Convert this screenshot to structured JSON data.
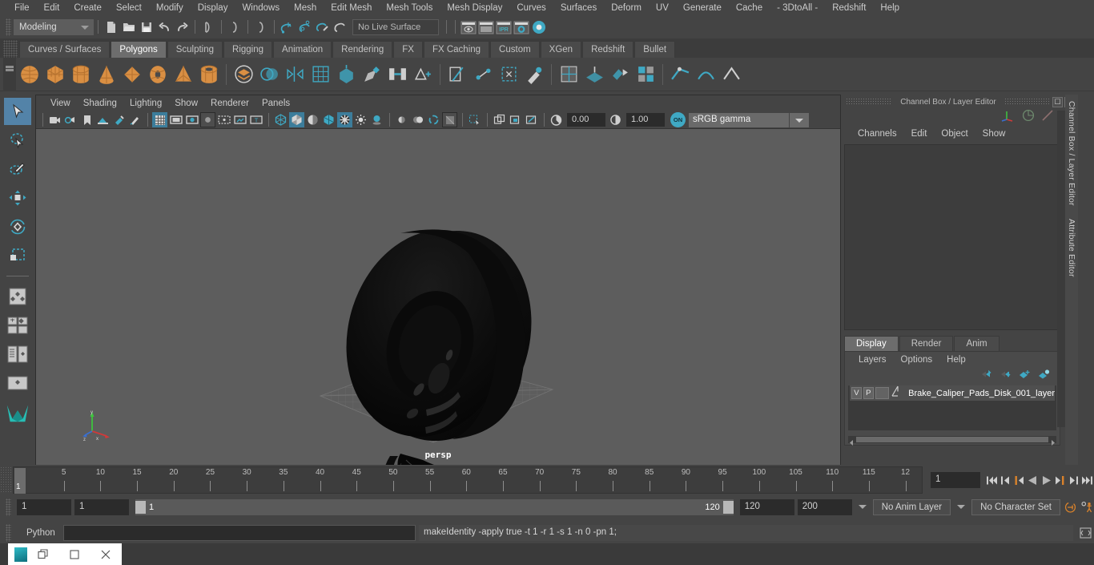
{
  "menubar": {
    "items": [
      "File",
      "Edit",
      "Create",
      "Select",
      "Modify",
      "Display",
      "Windows",
      "Mesh",
      "Edit Mesh",
      "Mesh Tools",
      "Mesh Display",
      "Curves",
      "Surfaces",
      "Deform",
      "UV",
      "Generate",
      "Cache",
      "- 3DtoAll -",
      "Redshift",
      "Help"
    ]
  },
  "statusline": {
    "menu_set": "Modeling",
    "live_surface": "No Live Surface",
    "icons": [
      "new-scene-icon",
      "open-scene-icon",
      "save-scene-icon",
      "undo-icon",
      "redo-icon",
      "select-by-hierarchy-icon",
      "select-by-object-icon",
      "select-by-component-icon",
      "snap-to-grid-icon",
      "snap-to-curve-icon",
      "snap-to-point-icon",
      "snap-to-projected-center-icon",
      "snap-to-view-plane-icon",
      "make-live-icon",
      "render-view-icon",
      "render-sequence-icon",
      "ipr-render-icon",
      "render-settings-icon",
      "hypershade-icon"
    ],
    "render_labels": [
      "IPR"
    ]
  },
  "shelf": {
    "tabs": [
      "Curves / Surfaces",
      "Polygons",
      "Sculpting",
      "Rigging",
      "Animation",
      "Rendering",
      "FX",
      "FX Caching",
      "Custom",
      "XGen",
      "Redshift",
      "Bullet"
    ],
    "active_tab": "Polygons",
    "icons": [
      "poly-sphere-icon",
      "poly-cube-icon",
      "poly-cylinder-icon",
      "poly-cone-icon",
      "poly-plane-icon",
      "poly-torus-icon",
      "poly-pyramid-icon",
      "poly-pipe-icon",
      "poly-combine-icon",
      "poly-booleans-icon",
      "poly-mirror-icon",
      "poly-smooth-icon",
      "poly-extrude-icon",
      "poly-bevel-icon",
      "poly-bridge-icon",
      "poly-append-icon",
      "poly-multicut-icon",
      "poly-target-weld-icon",
      "poly-quad-draw-icon",
      "poly-sculpt-icon",
      "poly-uv-editor-icon",
      "poly-planar-icon",
      "poly-unfold-icon",
      "poly-layout-icon",
      "crease-tool-icon",
      "soften-edge-icon",
      "harden-edge-icon",
      "cleanup-icon",
      "reduce-icon",
      "triangulate-icon"
    ]
  },
  "toolbox": {
    "tools": [
      "select-tool",
      "lasso-select-tool",
      "paint-select-tool",
      "move-tool",
      "rotate-tool",
      "scale-tool",
      "last-tool-used",
      "four-view-layout-icon",
      "single-perspective-layout-icon",
      "two-pane-layout-icon",
      "outliner-persp-layout-icon",
      "hypergraph-persp-layout-icon",
      "persp-graph-layout-icon",
      "maya-logo-icon"
    ],
    "active": "select-tool"
  },
  "viewport": {
    "menu": [
      "View",
      "Shading",
      "Lighting",
      "Show",
      "Renderer",
      "Panels"
    ],
    "camera_label": "persp",
    "exposure": "0.00",
    "gamma": "1.00",
    "gamma_toggle": "ON",
    "color_management": "sRGB gamma",
    "toolbar_icons": [
      "select-camera-icon",
      "camera-attributes-icon",
      "bookmark-icon",
      "image-plane-icon",
      "two-sided-lighting-icon",
      "paint-effects-icon",
      "grid-toggle-icon",
      "film-gate-icon",
      "resolution-gate-icon",
      "gate-mask-icon",
      "film-origin-icon",
      "safe-action-icon",
      "title-safe-icon",
      "wireframe-icon",
      "smooth-shade-icon",
      "flat-shade-icon",
      "shaded-wireframe-icon",
      "textured-icon",
      "use-default-lighting-icon",
      "shadows-icon",
      "ambient-occlusion-icon",
      "motion-blur-icon",
      "multisample-icon",
      "isolate-select-icon",
      "xray-icon",
      "xray-joints-icon",
      "xray-active-components-icon",
      "exposure-icon",
      "contrast-icon",
      "gamma-on-icon"
    ],
    "axis_labels": [
      "y",
      "z",
      "x"
    ]
  },
  "rightpanel": {
    "title": "Channel Box / Layer Editor",
    "win_buttons": [
      "restore-icon",
      "close-icon"
    ],
    "channel_menu": [
      "Channels",
      "Edit",
      "Object",
      "Show"
    ],
    "header_icons": [
      "axis-gizmo-icon",
      "channelbox-icon",
      "attribute-editor-icon"
    ],
    "layer_tabs": [
      "Display",
      "Render",
      "Anim"
    ],
    "active_layer_tab": "Display",
    "layer_menu": [
      "Layers",
      "Options",
      "Help"
    ],
    "layer_tool_icons": [
      "move-layer-up-icon",
      "move-layer-down-icon",
      "new-layer-icon",
      "new-layer-from-selected-icon"
    ],
    "layers": [
      {
        "visibility": "V",
        "playback": "P",
        "color_swatch": "",
        "name": "Brake_Caliper_Pads_Disk_001_layer"
      }
    ],
    "side_tabs": [
      "Channel Box / Layer Editor",
      "Attribute Editor"
    ]
  },
  "timeslider": {
    "tick_labels": [
      "5",
      "10",
      "15",
      "20",
      "25",
      "30",
      "35",
      "40",
      "45",
      "50",
      "55",
      "60",
      "65",
      "70",
      "75",
      "80",
      "85",
      "90",
      "95",
      "100",
      "105",
      "110",
      "115",
      "12"
    ],
    "current_frame_label": "1",
    "frame_field": "1",
    "playback_buttons": [
      "go-to-start-icon",
      "step-back-keyframe-icon",
      "step-back-frame-icon",
      "play-backwards-icon",
      "play-forwards-icon",
      "step-forward-frame-icon",
      "step-forward-keyframe-icon",
      "go-to-end-icon"
    ]
  },
  "rangeslider": {
    "anim_start": "1",
    "range_start": "1",
    "bar_start": "1",
    "bar_end": "120",
    "range_end": "120",
    "anim_end": "200",
    "anim_layer": "No Anim Layer",
    "character_set": "No Character Set",
    "right_icons": [
      "auto-keyframe-icon",
      "animation-preferences-icon"
    ]
  },
  "commandline": {
    "language": "Python",
    "input_value": "",
    "output": "makeIdentity -apply true -t 1 -r 1 -s 1 -n 0 -pn 1;",
    "expand_icon": "script-editor-icon"
  },
  "taskbar": {
    "window_icon": "maya-app-icon",
    "buttons": [
      "restore-window-icon",
      "maximize-window-icon",
      "close-window-icon"
    ]
  },
  "colors": {
    "accent_teal": "#3fa9c4",
    "accent_orange": "#d98f43",
    "selection_blue": "#5383a8",
    "bg_chrome": "#444444",
    "viewport_bg": "#5d5d5d",
    "playhead_orange": "#d9822b"
  }
}
